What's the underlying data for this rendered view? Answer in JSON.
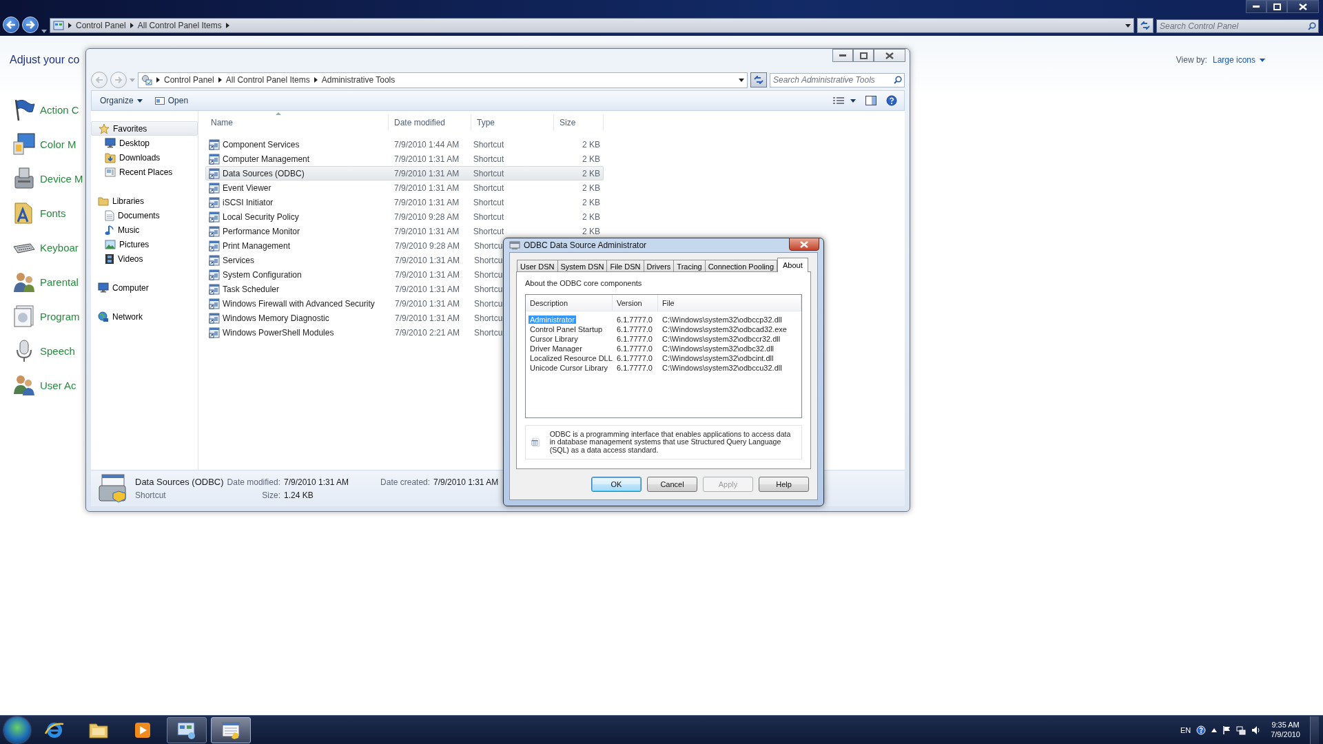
{
  "control_panel": {
    "breadcrumb": [
      "Control Panel",
      "All Control Panel Items"
    ],
    "search": {
      "placeholder": "Search Control Panel"
    },
    "heading": "Adjust your co",
    "view_by_label": "View by:",
    "view_by_value": "Large icons",
    "items": [
      {
        "label": "Action C"
      },
      {
        "label": "Color M"
      },
      {
        "label": "Device M"
      },
      {
        "label": "Fonts"
      },
      {
        "label": "Keyboar"
      },
      {
        "label": "Parental"
      },
      {
        "label": "Program"
      },
      {
        "label": "Speech"
      },
      {
        "label": "User Ac"
      }
    ]
  },
  "explorer": {
    "breadcrumb": [
      "Control Panel",
      "All Control Panel Items",
      "Administrative Tools"
    ],
    "search": {
      "placeholder": "Search Administrative Tools"
    },
    "toolbar": [
      "Organize",
      "Open"
    ],
    "nav": [
      {
        "label": "Favorites",
        "selected": true,
        "children": [
          {
            "label": "Desktop",
            "selected": false
          },
          {
            "label": "Downloads",
            "selected": false
          },
          {
            "label": "Recent Places",
            "selected": false
          }
        ]
      },
      {
        "label": "Libraries",
        "selected": false,
        "children": [
          {
            "label": "Documents",
            "selected": false
          },
          {
            "label": "Music",
            "selected": false
          },
          {
            "label": "Pictures",
            "selected": false
          },
          {
            "label": "Videos",
            "selected": false
          }
        ]
      },
      {
        "label": "Computer",
        "selected": false
      },
      {
        "label": "Network",
        "selected": false
      }
    ],
    "columns": [
      "Name",
      "Date modified",
      "Type",
      "Size"
    ],
    "rows": [
      {
        "name": "Component Services",
        "date": "7/9/2010 1:44 AM",
        "type": "Shortcut",
        "size": "2 KB",
        "selected": false
      },
      {
        "name": "Computer Management",
        "date": "7/9/2010 1:31 AM",
        "type": "Shortcut",
        "size": "2 KB",
        "selected": false
      },
      {
        "name": "Data Sources (ODBC)",
        "date": "7/9/2010 1:31 AM",
        "type": "Shortcut",
        "size": "2 KB",
        "selected": true
      },
      {
        "name": "Event Viewer",
        "date": "7/9/2010 1:31 AM",
        "type": "Shortcut",
        "size": "2 KB",
        "selected": false
      },
      {
        "name": "iSCSI Initiator",
        "date": "7/9/2010 1:31 AM",
        "type": "Shortcut",
        "size": "2 KB",
        "selected": false
      },
      {
        "name": "Local Security Policy",
        "date": "7/9/2010 9:28 AM",
        "type": "Shortcut",
        "size": "2 KB",
        "selected": false
      },
      {
        "name": "Performance Monitor",
        "date": "7/9/2010 1:31 AM",
        "type": "Shortcut",
        "size": "2 KB",
        "selected": false
      },
      {
        "name": "Print Management",
        "date": "7/9/2010 9:28 AM",
        "type": "Shortcu",
        "selected": false
      },
      {
        "name": "Services",
        "date": "7/9/2010 1:31 AM",
        "type": "Shortcu",
        "selected": false
      },
      {
        "name": "System Configuration",
        "date": "7/9/2010 1:31 AM",
        "type": "Shortcu",
        "selected": false
      },
      {
        "name": "Task Scheduler",
        "date": "7/9/2010 1:31 AM",
        "type": "Shortcu",
        "selected": false
      },
      {
        "name": "Windows Firewall with Advanced Security",
        "date": "7/9/2010 1:31 AM",
        "type": "Shortcu",
        "selected": false
      },
      {
        "name": "Windows Memory Diagnostic",
        "date": "7/9/2010 1:31 AM",
        "type": "Shortcu",
        "selected": false
      },
      {
        "name": "Windows PowerShell Modules",
        "date": "7/9/2010 2:21 AM",
        "type": "Shortcu",
        "selected": false
      }
    ],
    "details": {
      "name": "Data Sources (ODBC)",
      "type": "Shortcut",
      "modified_label": "Date modified:",
      "modified": "7/9/2010 1:31 AM",
      "size_label": "Size:",
      "size": "1.24 KB",
      "created_label": "Date created:",
      "created": "7/9/2010 1:31 AM"
    }
  },
  "dialog": {
    "title": "ODBC Data Source Administrator",
    "tabs": [
      {
        "label": "User DSN",
        "selected": false
      },
      {
        "label": "System DSN",
        "selected": false
      },
      {
        "label": "File DSN",
        "selected": false
      },
      {
        "label": "Drivers",
        "selected": false
      },
      {
        "label": "Tracing",
        "selected": false
      },
      {
        "label": "Connection Pooling",
        "selected": false
      },
      {
        "label": "About",
        "selected": true
      }
    ],
    "caption": "About the ODBC core components",
    "columns": [
      "Description",
      "Version",
      "File"
    ],
    "rows": [
      {
        "description": "Administrator",
        "version": "6.1.7777.0",
        "file": "C:\\Windows\\system32\\odbccp32.dll",
        "selected": true
      },
      {
        "description": "Control Panel Startup",
        "version": "6.1.7777.0",
        "file": "C:\\Windows\\system32\\odbcad32.exe",
        "selected": false
      },
      {
        "description": "Cursor Library",
        "version": "6.1.7777.0",
        "file": "C:\\Windows\\system32\\odbccr32.dll",
        "selected": false
      },
      {
        "description": "Driver Manager",
        "version": "6.1.7777.0",
        "file": "C:\\Windows\\system32\\odbc32.dll",
        "selected": false
      },
      {
        "description": "Localized Resource DLL",
        "version": "6.1.7777.0",
        "file": "C:\\Windows\\system32\\odbcint.dll",
        "selected": false
      },
      {
        "description": "Unicode Cursor Library",
        "version": "6.1.7777.0",
        "file": "C:\\Windows\\system32\\odbccu32.dll",
        "selected": false
      }
    ],
    "info": "ODBC is a programming interface that enables applications to access data in database management systems that use Structured Query Language (SQL) as a data access standard.",
    "buttons": [
      {
        "label": "OK",
        "default": true,
        "disabled": false
      },
      {
        "label": "Cancel",
        "default": false,
        "disabled": false
      },
      {
        "label": "Apply",
        "default": false,
        "disabled": true
      },
      {
        "label": "Help",
        "default": false,
        "disabled": false
      }
    ]
  },
  "taskbar": {
    "language": "EN",
    "time": "9:35 AM",
    "date": "7/9/2010"
  }
}
